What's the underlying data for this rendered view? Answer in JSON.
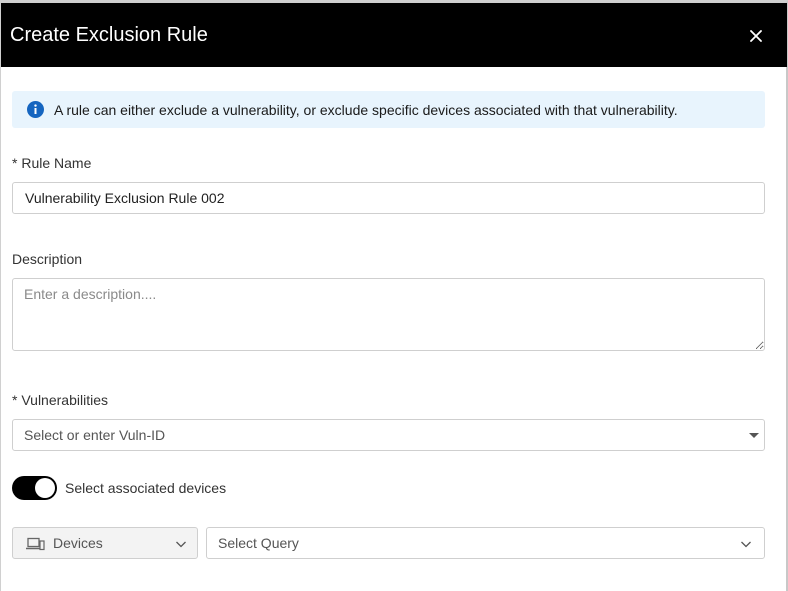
{
  "header": {
    "title": "Create Exclusion Rule",
    "close_icon": "close-icon"
  },
  "info": {
    "icon": "info-icon",
    "message": "A rule can either exclude a vulnerability, or exclude specific devices associated with that vulnerability."
  },
  "rule_name": {
    "label": "* Rule Name",
    "value": "Vulnerability Exclusion Rule 002"
  },
  "description": {
    "label": "Description",
    "placeholder": "Enter a description...."
  },
  "vulnerabilities": {
    "label": "* Vulnerabilities",
    "placeholder": "Select or enter Vuln-ID"
  },
  "associated_devices": {
    "toggle_on": true,
    "label": "Select associated devices"
  },
  "devices_select": {
    "icon": "laptop-icon",
    "value": "Devices"
  },
  "query_select": {
    "placeholder": "Select Query"
  },
  "colors": {
    "header_bg": "#000000",
    "info_bg": "#e8f4fd",
    "info_icon": "#1565c0",
    "toggle_on": "#000000"
  }
}
